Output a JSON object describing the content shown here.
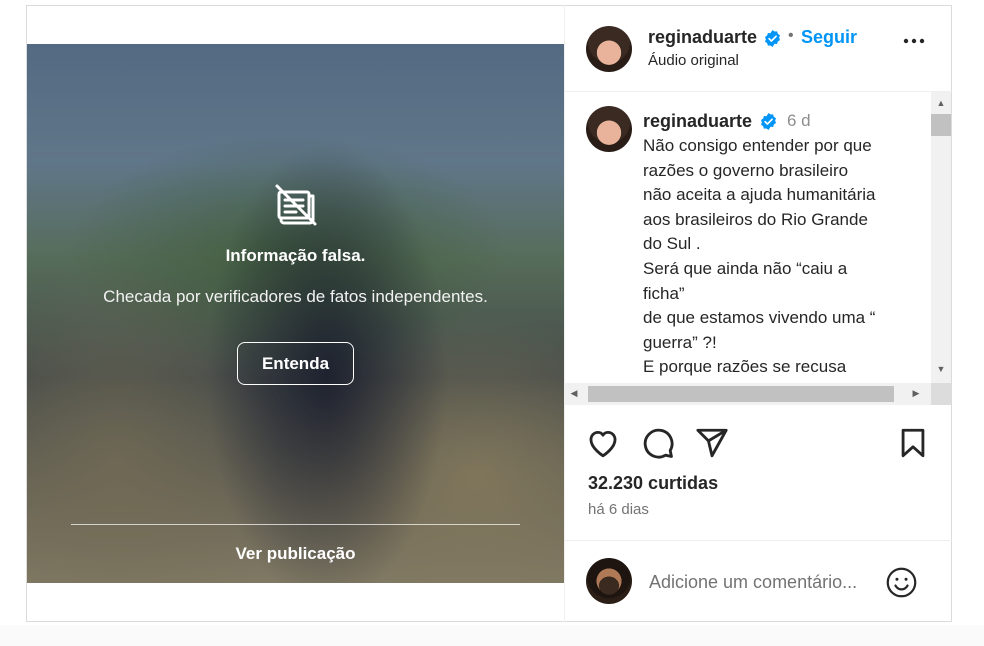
{
  "media": {
    "fact_check": {
      "title": "Informação falsa.",
      "subtitle": "Checada por verificadores de fatos independentes.",
      "learn_more_button": "Entenda",
      "view_post": "Ver publicação"
    }
  },
  "post_header": {
    "username": "reginaduarte",
    "separator": "•",
    "follow_label": "Seguir",
    "audio_label": "Áudio original"
  },
  "caption": {
    "username": "reginaduarte",
    "time_ago": "6 d",
    "text": "Não consigo entender por que\nrazões o governo brasileiro\nnão aceita a ajuda humanitária\naos brasileiros do Rio Grande\ndo Sul .\nSerá que ainda não “caiu a\nficha”\nde que estamos vivendo uma “\nguerra” ?!\nE porque razões se recusa"
  },
  "engagement": {
    "likes": "32.230 curtidas",
    "posted_ago": "há 6 dias"
  },
  "comment_box": {
    "placeholder": "Adicione um comentário..."
  },
  "colors": {
    "accent": "#0095f6",
    "verified_badge": "#0095f6",
    "text": "#262626",
    "secondary_text": "#737373"
  },
  "icons": [
    "fact-check-hidden-icon",
    "verified-badge-icon",
    "more-options-icon",
    "like-heart-icon",
    "comment-icon",
    "share-icon",
    "save-bookmark-icon",
    "emoji-icon"
  ]
}
